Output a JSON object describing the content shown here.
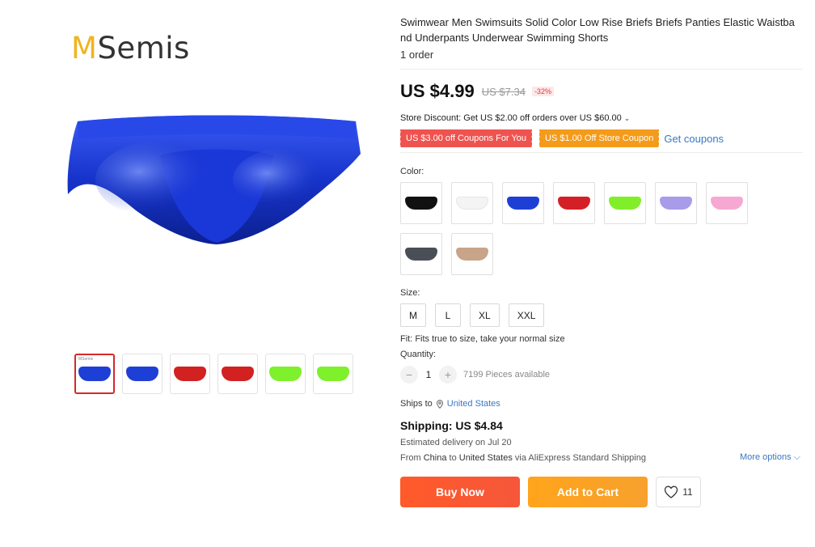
{
  "brand": {
    "initial": "M",
    "rest": "Semis"
  },
  "product": {
    "title": "Swimwear Men Swimsuits Solid Color Low Rise Briefs Briefs Panties Elastic Waistband Underpants Underwear Swimming Shorts",
    "orders": "1 order",
    "price": "US $4.99",
    "original_price": "US $7.34",
    "discount": "-32%"
  },
  "store_discount": {
    "text": "Store Discount: Get US $2.00 off orders over US $60.00",
    "chevron": "⌄"
  },
  "coupons": [
    {
      "label": "US $3.00 off Coupons For You",
      "color": "#ef5350"
    },
    {
      "label": "US $1.00 Off Store Coupon",
      "color": "#f49b1b"
    }
  ],
  "get_coupons": "Get coupons",
  "thumbnails": [
    {
      "color": "#1e3fd6",
      "brand": "MSemis"
    },
    {
      "color": "#1e3fd6"
    },
    {
      "color": "#d22121"
    },
    {
      "color": "#d22121"
    },
    {
      "color": "#7ff02c"
    },
    {
      "color": "#7ff02c"
    }
  ],
  "color_section": {
    "label": "Color:",
    "swatches": [
      "#111111",
      "#f4f4f4",
      "#1e3fd6",
      "#d51f26",
      "#80ef2a",
      "#a79bea",
      "#f7a8d2",
      "#4a4e57",
      "#c8a48a"
    ]
  },
  "size_section": {
    "label": "Size:",
    "options": [
      "M",
      "L",
      "XL",
      "XXL"
    ]
  },
  "fit": "Fit: Fits true to size, take your normal size",
  "quantity": {
    "label": "Quantity:",
    "minus": "−",
    "value": "1",
    "plus": "+",
    "available": "7199 Pieces available"
  },
  "ships_to": {
    "label": "Ships to",
    "country": "United States"
  },
  "shipping": {
    "cost": "Shipping: US $4.84",
    "estimate": "Estimated delivery on Jul 20",
    "from_prefix": "From",
    "from": "China",
    "to_word": "to",
    "to": "United States",
    "via": "via AliExpress Standard Shipping",
    "more": "More options"
  },
  "actions": {
    "buy": "Buy Now",
    "cart": "Add to Cart",
    "wishlist_count": "11"
  },
  "accent_colors": {
    "buy": "#ff5a2a",
    "cart": "#ffa41b",
    "link": "#3a78c2",
    "product": "#1e3fd6"
  }
}
